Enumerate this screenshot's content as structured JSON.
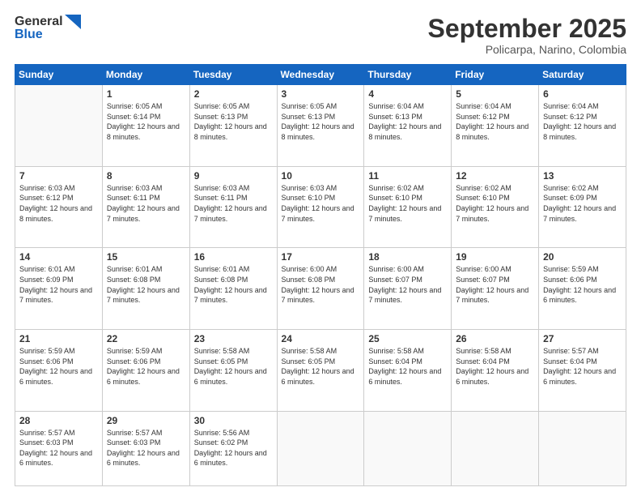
{
  "header": {
    "logo_general": "General",
    "logo_blue": "Blue",
    "month_title": "September 2025",
    "location": "Policarpa, Narino, Colombia"
  },
  "days_of_week": [
    "Sunday",
    "Monday",
    "Tuesday",
    "Wednesday",
    "Thursday",
    "Friday",
    "Saturday"
  ],
  "weeks": [
    [
      null,
      {
        "num": "1",
        "sunrise": "6:05 AM",
        "sunset": "6:14 PM",
        "daylight": "12 hours and 8 minutes."
      },
      {
        "num": "2",
        "sunrise": "6:05 AM",
        "sunset": "6:13 PM",
        "daylight": "12 hours and 8 minutes."
      },
      {
        "num": "3",
        "sunrise": "6:05 AM",
        "sunset": "6:13 PM",
        "daylight": "12 hours and 8 minutes."
      },
      {
        "num": "4",
        "sunrise": "6:04 AM",
        "sunset": "6:13 PM",
        "daylight": "12 hours and 8 minutes."
      },
      {
        "num": "5",
        "sunrise": "6:04 AM",
        "sunset": "6:12 PM",
        "daylight": "12 hours and 8 minutes."
      },
      {
        "num": "6",
        "sunrise": "6:04 AM",
        "sunset": "6:12 PM",
        "daylight": "12 hours and 8 minutes."
      }
    ],
    [
      {
        "num": "7",
        "sunrise": "6:03 AM",
        "sunset": "6:12 PM",
        "daylight": "12 hours and 8 minutes."
      },
      {
        "num": "8",
        "sunrise": "6:03 AM",
        "sunset": "6:11 PM",
        "daylight": "12 hours and 7 minutes."
      },
      {
        "num": "9",
        "sunrise": "6:03 AM",
        "sunset": "6:11 PM",
        "daylight": "12 hours and 7 minutes."
      },
      {
        "num": "10",
        "sunrise": "6:03 AM",
        "sunset": "6:10 PM",
        "daylight": "12 hours and 7 minutes."
      },
      {
        "num": "11",
        "sunrise": "6:02 AM",
        "sunset": "6:10 PM",
        "daylight": "12 hours and 7 minutes."
      },
      {
        "num": "12",
        "sunrise": "6:02 AM",
        "sunset": "6:10 PM",
        "daylight": "12 hours and 7 minutes."
      },
      {
        "num": "13",
        "sunrise": "6:02 AM",
        "sunset": "6:09 PM",
        "daylight": "12 hours and 7 minutes."
      }
    ],
    [
      {
        "num": "14",
        "sunrise": "6:01 AM",
        "sunset": "6:09 PM",
        "daylight": "12 hours and 7 minutes."
      },
      {
        "num": "15",
        "sunrise": "6:01 AM",
        "sunset": "6:08 PM",
        "daylight": "12 hours and 7 minutes."
      },
      {
        "num": "16",
        "sunrise": "6:01 AM",
        "sunset": "6:08 PM",
        "daylight": "12 hours and 7 minutes."
      },
      {
        "num": "17",
        "sunrise": "6:00 AM",
        "sunset": "6:08 PM",
        "daylight": "12 hours and 7 minutes."
      },
      {
        "num": "18",
        "sunrise": "6:00 AM",
        "sunset": "6:07 PM",
        "daylight": "12 hours and 7 minutes."
      },
      {
        "num": "19",
        "sunrise": "6:00 AM",
        "sunset": "6:07 PM",
        "daylight": "12 hours and 7 minutes."
      },
      {
        "num": "20",
        "sunrise": "5:59 AM",
        "sunset": "6:06 PM",
        "daylight": "12 hours and 6 minutes."
      }
    ],
    [
      {
        "num": "21",
        "sunrise": "5:59 AM",
        "sunset": "6:06 PM",
        "daylight": "12 hours and 6 minutes."
      },
      {
        "num": "22",
        "sunrise": "5:59 AM",
        "sunset": "6:06 PM",
        "daylight": "12 hours and 6 minutes."
      },
      {
        "num": "23",
        "sunrise": "5:58 AM",
        "sunset": "6:05 PM",
        "daylight": "12 hours and 6 minutes."
      },
      {
        "num": "24",
        "sunrise": "5:58 AM",
        "sunset": "6:05 PM",
        "daylight": "12 hours and 6 minutes."
      },
      {
        "num": "25",
        "sunrise": "5:58 AM",
        "sunset": "6:04 PM",
        "daylight": "12 hours and 6 minutes."
      },
      {
        "num": "26",
        "sunrise": "5:58 AM",
        "sunset": "6:04 PM",
        "daylight": "12 hours and 6 minutes."
      },
      {
        "num": "27",
        "sunrise": "5:57 AM",
        "sunset": "6:04 PM",
        "daylight": "12 hours and 6 minutes."
      }
    ],
    [
      {
        "num": "28",
        "sunrise": "5:57 AM",
        "sunset": "6:03 PM",
        "daylight": "12 hours and 6 minutes."
      },
      {
        "num": "29",
        "sunrise": "5:57 AM",
        "sunset": "6:03 PM",
        "daylight": "12 hours and 6 minutes."
      },
      {
        "num": "30",
        "sunrise": "5:56 AM",
        "sunset": "6:02 PM",
        "daylight": "12 hours and 6 minutes."
      },
      null,
      null,
      null,
      null
    ]
  ]
}
